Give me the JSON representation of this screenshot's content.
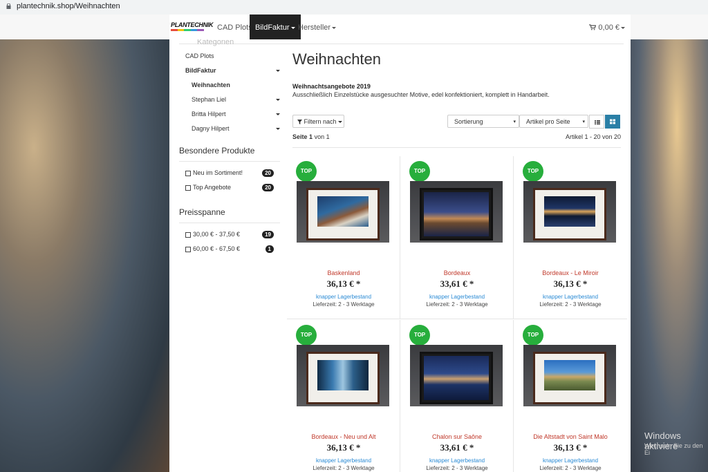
{
  "browser": {
    "url": "plantechnik.shop/Weihnachten"
  },
  "nav": {
    "logo_text": "PLANTECHNIK",
    "items": [
      {
        "label": "CAD Plots"
      },
      {
        "label": "BildFaktur"
      },
      {
        "label": "Hersteller"
      }
    ],
    "cart": "0,00 €"
  },
  "breadcrumb": {
    "home": "⌂",
    "parent": "BildFaktur",
    "current": "Weihnachten",
    "faded_header": "Kategorien"
  },
  "sidebar": {
    "categories": [
      {
        "label": "CAD Plots"
      },
      {
        "label": "BildFaktur"
      },
      {
        "label": "Weihnachten"
      },
      {
        "label": "Stephan Liel"
      },
      {
        "label": "Britta Hilpert"
      },
      {
        "label": "Dagny Hilpert"
      }
    ],
    "special_title": "Besondere Produkte",
    "special": [
      {
        "label": "Neu im Sortiment!",
        "count": "20"
      },
      {
        "label": "Top Angebote",
        "count": "20"
      }
    ],
    "price_title": "Preisspanne",
    "prices": [
      {
        "label": "30,00 € - 37,50 €",
        "count": "19"
      },
      {
        "label": "60,00 € - 67,50 €",
        "count": "1"
      }
    ]
  },
  "main": {
    "title": "Weihnachten",
    "subtitle": "Weihnachtsangebote 2019",
    "description": "Ausschließlich Einzelstücke ausgesuchter Motive, edel konfektioniert, komplett in Handarbeit.",
    "filter_label": "Filtern nach",
    "sort_label": "Sortierung",
    "per_page_label": "Artikel pro Seite",
    "page_label": "Seite",
    "page_num": "1",
    "page_of": "von 1",
    "articles": "Artikel 1 - 20 von 20"
  },
  "products": [
    {
      "badge": "TOP",
      "name": "Baskenland",
      "price": "36,13 € *",
      "stock": "knapper Lagerbestand",
      "shipping": "Lieferzeit: 2 - 3 Werktage"
    },
    {
      "badge": "TOP",
      "name": "Bordeaux",
      "price": "33,61 € *",
      "stock": "knapper Lagerbestand",
      "shipping": "Lieferzeit: 2 - 3 Werktage"
    },
    {
      "badge": "TOP",
      "name": "Bordeaux - Le Miroir",
      "price": "36,13 € *",
      "stock": "knapper Lagerbestand",
      "shipping": "Lieferzeit: 2 - 3 Werktage"
    },
    {
      "badge": "TOP",
      "name": "Bordeaux - Neu und Alt",
      "price": "36,13 € *",
      "stock": "knapper Lagerbestand",
      "shipping": "Lieferzeit: 2 - 3 Werktage"
    },
    {
      "badge": "TOP",
      "name": "Chalon sur Saône",
      "price": "33,61 € *",
      "stock": "knapper Lagerbestand",
      "shipping": "Lieferzeit: 2 - 3 Werktage"
    },
    {
      "badge": "TOP",
      "name": "Die Altstadt von Saint Malo",
      "price": "36,13 € *",
      "stock": "knapper Lagerbestand",
      "shipping": "Lieferzeit: 2 - 3 Werktage"
    }
  ],
  "windows": {
    "line1": "Windows aktiviere",
    "line2": "Wechseln Sie zu den Ei"
  },
  "colors": {
    "accent": "#c0392b",
    "badge": "#27ae3c",
    "active_view": "#2a7fa6",
    "stock": "#2a8ad4"
  }
}
